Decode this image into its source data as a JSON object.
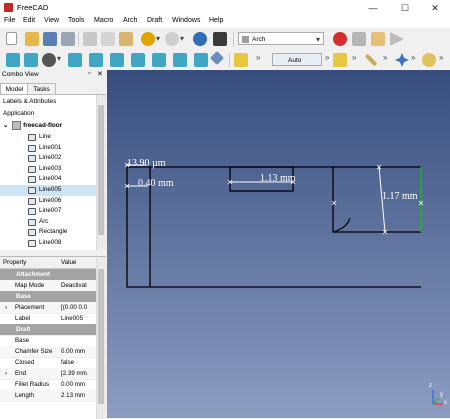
{
  "window": {
    "title": "FreeCAD",
    "minimize": "—",
    "maximize": "☐",
    "close": "✕"
  },
  "menubar": [
    "File",
    "Edit",
    "View",
    "Tools",
    "Macro",
    "Arch",
    "Draft",
    "Windows",
    "Help"
  ],
  "toolbar": {
    "workbench": "Arch",
    "snap_mode": "Auto",
    "more": "»"
  },
  "combo_view": {
    "title": "Combo View",
    "tabs": [
      "Model",
      "Tasks"
    ],
    "labels_header": "Labels & Attributes",
    "application": "Application",
    "document": "freecad-floor",
    "items": [
      "Line",
      "Line001",
      "Line002",
      "Line003",
      "Line004",
      "Line005",
      "Line006",
      "Line007",
      "Arc",
      "Rectangle",
      "Line008"
    ],
    "selected_index": 5
  },
  "property_view": {
    "columns": [
      "Property",
      "Value"
    ],
    "rows": [
      {
        "type": "group",
        "name": "Attachment"
      },
      {
        "type": "prop",
        "name": "Map Mode",
        "value": "Deactivat"
      },
      {
        "type": "group",
        "name": "Base"
      },
      {
        "type": "prop",
        "name": "Placement",
        "value": "[(0.00 0.0",
        "expand": true
      },
      {
        "type": "prop",
        "name": "Label",
        "value": "Line005"
      },
      {
        "type": "group",
        "name": "Draft"
      },
      {
        "type": "prop",
        "name": "Base",
        "value": ""
      },
      {
        "type": "prop",
        "name": "Chamfer Size",
        "value": "0.00 mm"
      },
      {
        "type": "prop",
        "name": "Closed",
        "value": "false"
      },
      {
        "type": "prop",
        "name": "End",
        "value": "[2.39 mm",
        "expand": true
      },
      {
        "type": "prop",
        "name": "Fillet Radius",
        "value": "0.00 mm"
      },
      {
        "type": "prop",
        "name": "Length",
        "value": "2.13 mm"
      }
    ]
  },
  "view3d": {
    "dimensions": [
      "13.90 µm",
      "0.40 mm",
      "1.13 mm",
      "1.17 mm"
    ],
    "axis_labels": [
      "z",
      "y",
      "x"
    ],
    "line_color": "#000000",
    "highlight_color": "#1db02b",
    "dim_color": "#ffffff"
  },
  "colors": {
    "record_button": "#d32f2f",
    "viewbg_top": "#364d7d",
    "viewbg_bottom": "#8d9dc2"
  }
}
